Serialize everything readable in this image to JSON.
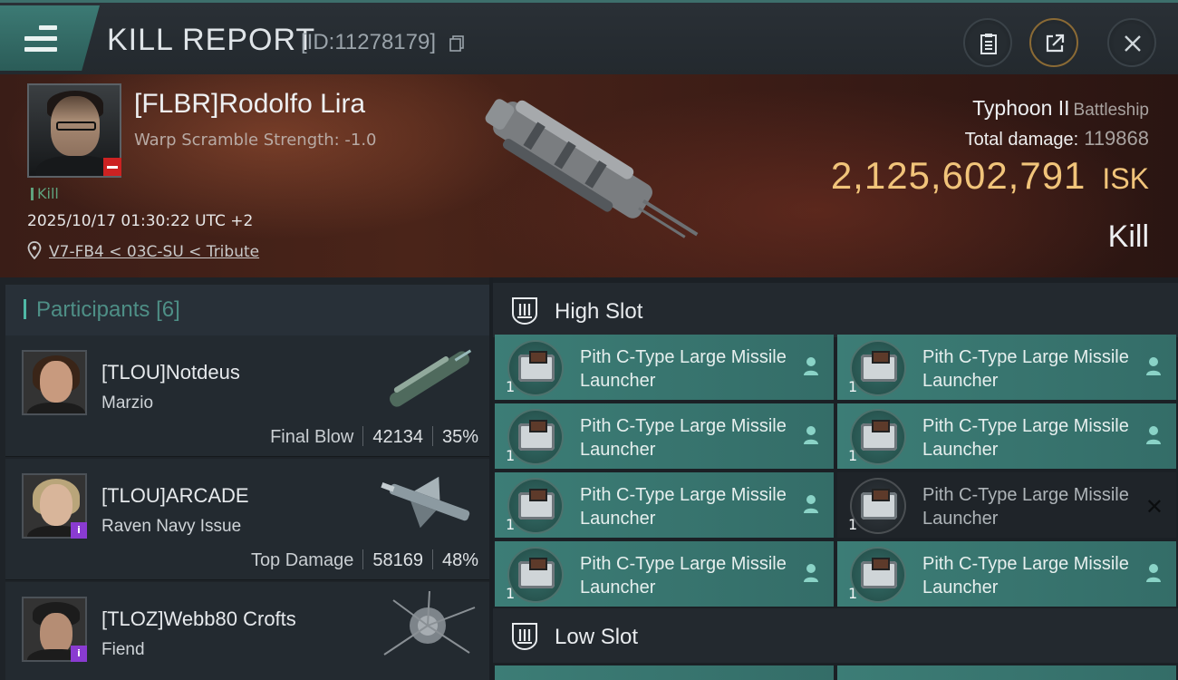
{
  "header": {
    "title": "KILL REPORT",
    "report_id": "[ID:11278179]"
  },
  "victim": {
    "name": "[FLBR]Rodolfo Lira",
    "warp_scramble": "Warp Scramble Strength: -1.0",
    "tag": "Kill",
    "datetime": "2025/10/17 01:30:22 UTC +2",
    "location": "V7-FB4 < 03C-SU < Tribute",
    "ship_name": "Typhoon II",
    "ship_class": "Battleship",
    "total_damage_label": "Total damage:",
    "total_damage": "119868",
    "isk_value": "2,125,602,791",
    "isk_unit": "ISK",
    "result": "Kill"
  },
  "participants": {
    "title": "Participants",
    "count": "[6]",
    "items": [
      {
        "name": "[TLOU]Notdeus",
        "ship": "Marzio",
        "role": "Final Blow",
        "damage": "42134",
        "percent": "35%"
      },
      {
        "name": "[TLOU]ARCADE",
        "ship": "Raven Navy Issue",
        "role": "Top Damage",
        "damage": "58169",
        "percent": "48%"
      },
      {
        "name": "[TLOZ]Webb80 Crofts",
        "ship": "Fiend"
      }
    ]
  },
  "slots": {
    "high_title": "High Slot",
    "low_title": "Low Slot",
    "high_modules": [
      {
        "name": "Pith C-Type Large Missile Launcher",
        "qty": "1"
      },
      {
        "name": "Pith C-Type Large Missile Launcher",
        "qty": "1"
      },
      {
        "name": "Pith C-Type Large Missile Launcher",
        "qty": "1"
      },
      {
        "name": "Pith C-Type Large Missile Launcher",
        "qty": "1"
      },
      {
        "name": "Pith C-Type Large Missile Launcher",
        "qty": "1"
      },
      {
        "name": "Pith C-Type Large Missile Launcher",
        "qty": "1"
      },
      {
        "name": "Pith C-Type Large Missile Launcher",
        "qty": "1"
      },
      {
        "name": "Pith C-Type Large Missile Launcher",
        "qty": "1"
      }
    ]
  },
  "colors": {
    "accent_teal": "#3c7d76",
    "isk_gold": "#f1c47a",
    "kill_green": "#5fa27d"
  }
}
